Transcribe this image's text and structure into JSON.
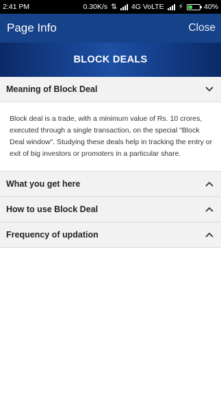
{
  "status_bar": {
    "time": "2:41 PM",
    "speed": "0.30K/s",
    "network": "4G VoLTE",
    "battery": "40%",
    "battery_level": 0.4
  },
  "app_bar": {
    "title": "Page Info",
    "close_label": "Close"
  },
  "banner": {
    "title": "BLOCK DEALS"
  },
  "sections": [
    {
      "title": "Meaning of Block Deal",
      "expanded": true,
      "body": "Block deal is a trade, with a minimum value of Rs. 10 crores, executed through a single transaction, on the special \"Block Deal window\". Studying these deals help in tracking the entry or exit of big investors or promoters in a particular share."
    },
    {
      "title": "What you get here",
      "expanded": false
    },
    {
      "title": "How to use Block Deal",
      "expanded": false
    },
    {
      "title": "Frequency of updation",
      "expanded": false
    }
  ],
  "colors": {
    "app_bar": "#16428a",
    "banner": "#15418e",
    "section_header_bg": "#f2f2f2",
    "battery_fill": "#3ee04f"
  }
}
